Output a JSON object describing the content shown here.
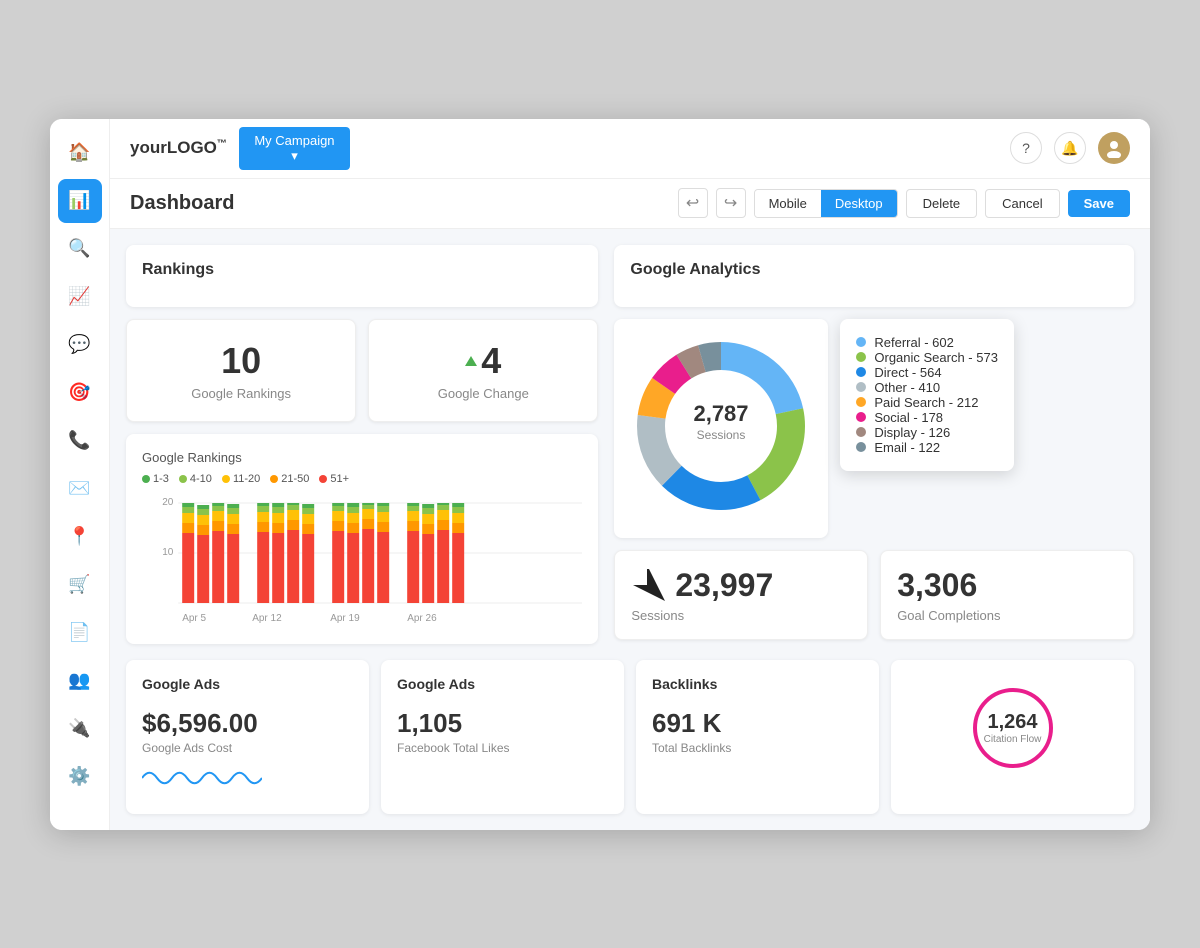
{
  "app": {
    "logo": "yourLOGO™",
    "campaign_btn": "My Campaign ▾"
  },
  "header": {
    "help_icon": "?",
    "bell_icon": "🔔",
    "avatar_initial": "👤"
  },
  "toolbar": {
    "title": "Dashboard",
    "undo_label": "↩",
    "redo_label": "↪",
    "mobile_label": "Mobile",
    "desktop_label": "Desktop",
    "delete_label": "Delete",
    "cancel_label": "Cancel",
    "save_label": "Save"
  },
  "rankings": {
    "title": "Rankings",
    "google_rankings_value": "10",
    "google_rankings_label": "Google Rankings",
    "google_change_value": "4",
    "google_change_label": "Google Change",
    "chart_title": "Google Rankings",
    "legend": [
      {
        "label": "1-3",
        "color": "#4CAF50"
      },
      {
        "label": "4-10",
        "color": "#8BC34A"
      },
      {
        "label": "11-20",
        "color": "#FFC107"
      },
      {
        "label": "21-50",
        "color": "#FF9800"
      },
      {
        "label": "51+",
        "color": "#F44336"
      }
    ],
    "x_labels": [
      "Apr 5",
      "Apr 12",
      "Apr 19",
      "Apr 26"
    ],
    "y_labels": [
      "20",
      "10"
    ]
  },
  "google_analytics": {
    "title": "Google Analytics",
    "donut": {
      "center_value": "2,787",
      "center_label": "Sessions",
      "segments": [
        {
          "label": "Referral - 602",
          "color": "#64B5F6",
          "value": 602,
          "pct": 21.6
        },
        {
          "label": "Organic Search - 573",
          "color": "#8BC34A",
          "value": 573,
          "pct": 20.6
        },
        {
          "label": "Direct - 564",
          "color": "#1E88E5",
          "value": 564,
          "pct": 20.2
        },
        {
          "label": "Other - 410",
          "color": "#B0BEC5",
          "value": 410,
          "pct": 14.7
        },
        {
          "label": "Paid Search - 212",
          "color": "#FFA726",
          "value": 212,
          "pct": 7.6
        },
        {
          "label": "Social - 178",
          "color": "#E91E8C",
          "value": 178,
          "pct": 6.4
        },
        {
          "label": "Display - 126",
          "color": "#A1887F",
          "value": 126,
          "pct": 4.5
        },
        {
          "label": "Email - 122",
          "color": "#78909C",
          "value": 122,
          "pct": 4.4
        }
      ]
    },
    "sessions_value": "23,997",
    "sessions_label": "Sessions",
    "goal_completions_value": "3,306",
    "goal_completions_label": "Goal Completions"
  },
  "google_ads_1": {
    "title": "Google Ads",
    "value": "$6,596.00",
    "label": "Google Ads Cost"
  },
  "google_ads_2": {
    "title": "Google Ads",
    "value": "1,105",
    "label": "Facebook Total Likes"
  },
  "backlinks": {
    "title": "Backlinks",
    "value": "691 K",
    "label": "Total Backlinks"
  },
  "citation": {
    "title": "",
    "value": "1,264",
    "label": "Citation Flow"
  }
}
